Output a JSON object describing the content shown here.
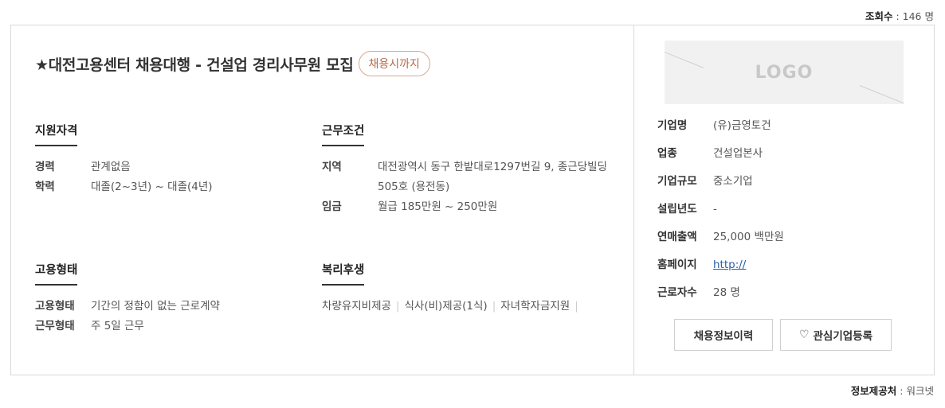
{
  "views": {
    "label": "조회수",
    "sep": " : ",
    "value": "146 명"
  },
  "title": "★대전고용센터 채용대행 - 건설업 경리사무원 모집",
  "deadline_badge": "채용시까지",
  "qualification": {
    "heading": "지원자격",
    "rows": [
      {
        "key": "경력",
        "value": "관계없음"
      },
      {
        "key": "학력",
        "value": "대졸(2~3년) ~ 대졸(4년)"
      }
    ]
  },
  "conditions": {
    "heading": "근무조건",
    "rows": [
      {
        "key": "지역",
        "value": "대전광역시 동구 한밭대로1297번길 9, 종근당빌딩 505호 (용전동)"
      },
      {
        "key": "임금",
        "value": "월급 185만원 ~ 250만원"
      }
    ]
  },
  "employment": {
    "heading": "고용형태",
    "rows": [
      {
        "key": "고용형태",
        "value": "기간의 정함이 없는 근로계약"
      },
      {
        "key": "근무형태",
        "value": "주 5일 근무"
      }
    ]
  },
  "welfare": {
    "heading": "복리후생",
    "items": [
      "차량유지비제공",
      "식사(비)제공(1식)",
      "자녀학자금지원"
    ]
  },
  "company": {
    "logo_text": "LOGO",
    "rows": [
      {
        "key": "기업명",
        "value": "(유)금영토건"
      },
      {
        "key": "업종",
        "value": "건설업본사"
      },
      {
        "key": "기업규모",
        "value": "중소기업"
      },
      {
        "key": "설립년도",
        "value": "-"
      },
      {
        "key": "연매출액",
        "value": "25,000 백만원"
      },
      {
        "key": "홈페이지",
        "value": "http://"
      },
      {
        "key": "근로자수",
        "value": "28 명"
      }
    ]
  },
  "buttons": {
    "history": "채용정보이력",
    "interest": "관심기업등록"
  },
  "provider": {
    "label": "정보제공처",
    "sep": " : ",
    "value": "워크넷"
  }
}
